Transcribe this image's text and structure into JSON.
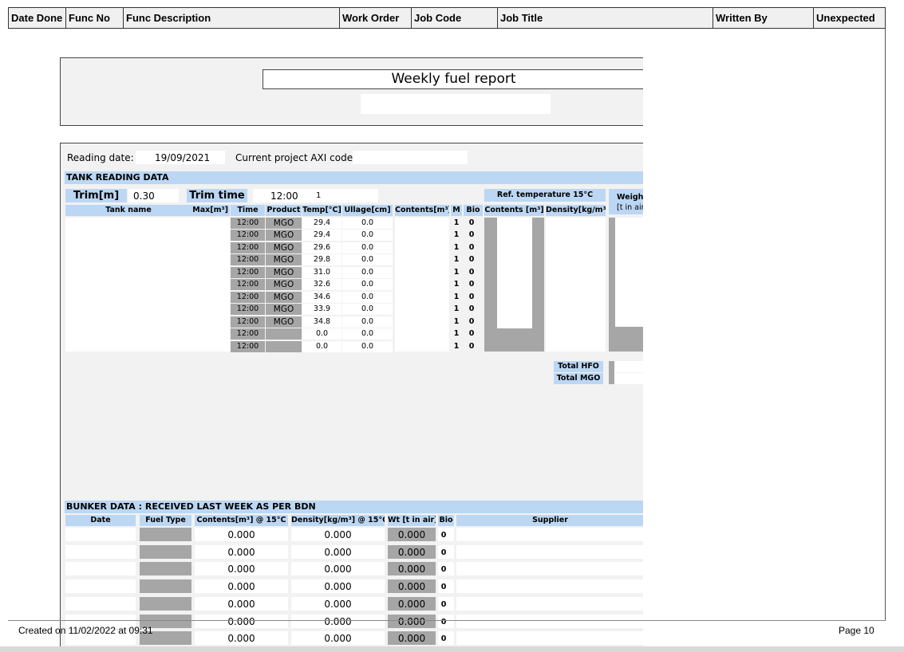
{
  "header": {
    "columns": [
      "Date Done",
      "Func No",
      "Func Description",
      "Work Order",
      "Job Code",
      "Job Title",
      "Written By",
      "Unexpected"
    ]
  },
  "report": {
    "title": "Weekly fuel report",
    "reading_date_label": "Reading date:",
    "reading_date": "19/09/2021",
    "axi_label": "Current project AXI code:",
    "tank_section": "TANK READING DATA",
    "trim_label": "Trim[m]",
    "trim_value": "0.30",
    "trim_time_label": "Trim time",
    "trim_time_value": "12:00",
    "trim_extra": "1",
    "ref_temp_label": "Ref. temperature 15°C",
    "weight_label_1": "Weight",
    "weight_label_2": "[t in air",
    "tank_columns": {
      "tank_name": "Tank name",
      "max": "Max[m³]",
      "time": "Time",
      "product": "Product",
      "temp": "Temp[°C]",
      "ullage": "Ullage[cm]",
      "contents": "Contents[m³]",
      "m": "M",
      "bio": "Bio",
      "ref_contents": "Contents [m³]",
      "density": "Density[kg/m³]"
    },
    "tank_rows": [
      {
        "time": "12:00",
        "product": "MGO",
        "temp": "29.4",
        "ullage": "0.0",
        "m": "1",
        "bio": "0"
      },
      {
        "time": "12:00",
        "product": "MGO",
        "temp": "29.4",
        "ullage": "0.0",
        "m": "1",
        "bio": "0"
      },
      {
        "time": "12:00",
        "product": "MGO",
        "temp": "29.6",
        "ullage": "0.0",
        "m": "1",
        "bio": "0"
      },
      {
        "time": "12:00",
        "product": "MGO",
        "temp": "29.8",
        "ullage": "0.0",
        "m": "1",
        "bio": "0"
      },
      {
        "time": "12:00",
        "product": "MGO",
        "temp": "31.0",
        "ullage": "0.0",
        "m": "1",
        "bio": "0"
      },
      {
        "time": "12:00",
        "product": "MGO",
        "temp": "32.6",
        "ullage": "0.0",
        "m": "1",
        "bio": "0"
      },
      {
        "time": "12:00",
        "product": "MGO",
        "temp": "34.6",
        "ullage": "0.0",
        "m": "1",
        "bio": "0"
      },
      {
        "time": "12:00",
        "product": "MGO",
        "temp": "33.9",
        "ullage": "0.0",
        "m": "1",
        "bio": "0"
      },
      {
        "time": "12:00",
        "product": "MGO",
        "temp": "34.8",
        "ullage": "0.0",
        "m": "1",
        "bio": "0"
      },
      {
        "time": "12:00",
        "product": "",
        "temp": "0.0",
        "ullage": "0.0",
        "m": "1",
        "bio": "0"
      },
      {
        "time": "12:00",
        "product": "",
        "temp": "0.0",
        "ullage": "0.0",
        "m": "1",
        "bio": "0"
      }
    ],
    "total_hfo": "Total HFO",
    "total_mgo": "Total MGO",
    "bunker_section": "BUNKER DATA : RECEIVED LAST WEEK AS PER BDN",
    "bunker_columns": {
      "date": "Date",
      "fuel_type": "Fuel Type",
      "contents": "Contents[m³] @ 15°C",
      "density": "Density[kg/m³] @ 15°C",
      "wt": "Wt [t in air]",
      "bio": "Bio",
      "supplier": "Supplier"
    },
    "bunker_rows": [
      {
        "contents": "0.000",
        "density": "0.000",
        "wt": "0.000",
        "bio": "0"
      },
      {
        "contents": "0.000",
        "density": "0.000",
        "wt": "0.000",
        "bio": "0"
      },
      {
        "contents": "0.000",
        "density": "0.000",
        "wt": "0.000",
        "bio": "0"
      },
      {
        "contents": "0.000",
        "density": "0.000",
        "wt": "0.000",
        "bio": "0"
      },
      {
        "contents": "0.000",
        "density": "0.000",
        "wt": "0.000",
        "bio": "0"
      },
      {
        "contents": "0.000",
        "density": "0.000",
        "wt": "0.000",
        "bio": "0"
      },
      {
        "contents": "0.000",
        "density": "0.000",
        "wt": "0.000",
        "bio": "0"
      }
    ]
  },
  "footer": {
    "created": "Created on 11/02/2022 at 09:31",
    "page": "Page 10"
  }
}
